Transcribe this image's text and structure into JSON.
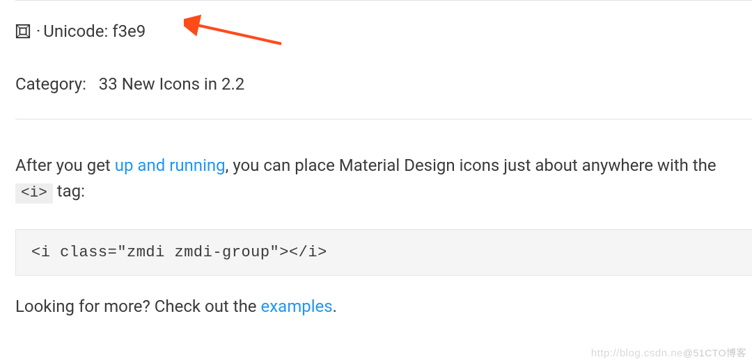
{
  "meta": {
    "icon_name": "group-icon",
    "separator": "·",
    "unicode_label": "Unicode:",
    "unicode_value": "f3e9"
  },
  "category": {
    "label": "Category:",
    "value": "33 New Icons in 2.2"
  },
  "body": {
    "p1_before_link": "After you get ",
    "p1_link": "up and running",
    "p1_after_link": ", you can place Material Design icons just about anywhere with the ",
    "p1_code": "<i>",
    "p1_after_code": " tag:"
  },
  "code_example": "<i class=\"zmdi zmdi-group\"></i>",
  "footer": {
    "before_link": "Looking for more? Check out the ",
    "link": "examples",
    "after_link": "."
  },
  "watermark": {
    "url": "http://blog.csdn.ne",
    "suffix": "@51CTO博客"
  }
}
